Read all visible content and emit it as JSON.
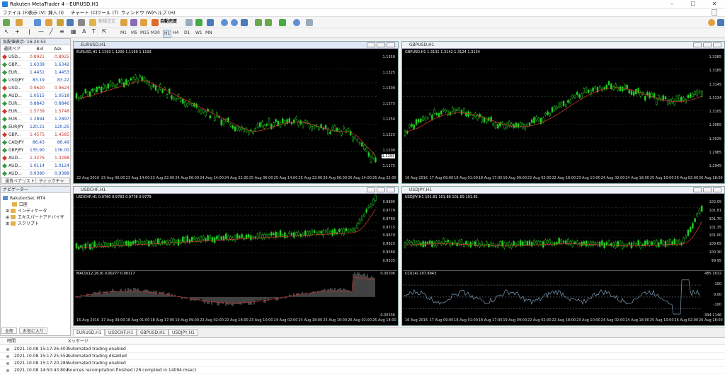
{
  "window": {
    "title": "Rakuten MetaTrader 4 - EURUSD,H1"
  },
  "menu": [
    "ファイル (F)",
    "表示 (V)",
    "挿入 (I)",
    "チャート (C)",
    "ツール (T)",
    "ウィンドウ (W)",
    "ヘルプ (H)"
  ],
  "toolbar": {
    "new_order": "新規注文",
    "auto_trade": "自動売買"
  },
  "timeframes": [
    "M1",
    "M5",
    "M15",
    "M30",
    "H1",
    "H4",
    "D1",
    "W1",
    "MN"
  ],
  "market_watch": {
    "title": "気配値表示: 16:24:53",
    "col_symbol": "通貨ペア",
    "col_bid": "Bid",
    "col_ask": "Ask",
    "rows": [
      {
        "symbol": "USD...",
        "bid": "0.8921",
        "ask": "0.8925",
        "dir": "down"
      },
      {
        "symbol": "GBP...",
        "bid": "1.6339",
        "ask": "1.6342",
        "dir": "up"
      },
      {
        "symbol": "EUR...",
        "bid": "1.4451",
        "ask": "1.4453",
        "dir": "up"
      },
      {
        "symbol": "USDJPY",
        "bid": "83.19",
        "ask": "83.22",
        "dir": "up"
      },
      {
        "symbol": "USD...",
        "bid": "0.9620",
        "ask": "0.9624",
        "dir": "down"
      },
      {
        "symbol": "AUD...",
        "bid": "1.0515",
        "ask": "1.0518",
        "dir": "up"
      },
      {
        "symbol": "EUR...",
        "bid": "0.8843",
        "ask": "0.8846",
        "dir": "up"
      },
      {
        "symbol": "EUR...",
        "bid": "1.5739",
        "ask": "1.5748",
        "dir": "down"
      },
      {
        "symbol": "EUR...",
        "bid": "1.2894",
        "ask": "1.2897",
        "dir": "up"
      },
      {
        "symbol": "EURJPY",
        "bid": "120.21",
        "ask": "120.25",
        "dir": "up"
      },
      {
        "symbol": "GBP...",
        "bid": "1.4575",
        "ask": "1.4585",
        "dir": "down"
      },
      {
        "symbol": "CADJPY",
        "bid": "86.43",
        "ask": "86.49",
        "dir": "up"
      },
      {
        "symbol": "GBPJPY",
        "bid": "135.90",
        "ask": "136.00",
        "dir": "up"
      },
      {
        "symbol": "AUD...",
        "bid": "1.3276",
        "ask": "1.3288",
        "dir": "down"
      },
      {
        "symbol": "AUD...",
        "bid": "1.0114",
        "ask": "1.0124",
        "dir": "up"
      },
      {
        "symbol": "AUD...",
        "bid": "0.9380",
        "ask": "0.9388",
        "dir": "up"
      }
    ],
    "tab_symbols": "通貨ペアリスト",
    "tab_tick": "ティックチャート"
  },
  "navigator": {
    "title": "ナビゲーター",
    "root": "RakutenSec MT4",
    "items": [
      "口座",
      "インディケータ",
      "エキスパートアドバイザ",
      "スクリプト"
    ],
    "tab_common": "全般",
    "tab_fav": "お気に入り"
  },
  "charts": [
    {
      "tab": "EURUSD,H1",
      "info": "EURUSD,H1  1.1193 1.1200 1.1190 1.1193",
      "prices": [
        "1.1350",
        "1.1325",
        "1.1300",
        "1.1275",
        "1.1250",
        "1.1225",
        "1.1200",
        "1.1175"
      ],
      "current": "1.1193",
      "times": [
        "22 Aug 2016",
        "23 Aug 06:00",
        "23 Aug 14:00",
        "23 Aug 22:00",
        "24 Aug 06:00",
        "24 Aug 14:00",
        "24 Aug 22:00",
        "25 Aug 06:00",
        "25 Aug 14:00",
        "25 Aug 22:00",
        "26 Aug 06:00",
        "26 Aug 14:00",
        "26 Aug 22:00"
      ]
    },
    {
      "tab": "GBPUSD,H1",
      "info": "GBPUSD,H1  1.3131 1.3142 1.3124 1.3134",
      "prices": [
        "1.3265",
        "1.3185",
        "1.3145",
        "1.3134",
        "1.3105",
        "1.3065",
        "1.3025",
        "1.2985",
        "1.2945"
      ],
      "times": [
        "16 Aug 2016",
        "17 Aug 09:00",
        "18 Aug 01:00",
        "18 Aug 17:00",
        "19 Aug 09:00",
        "22 Aug 02:00",
        "22 Aug 18:00",
        "23 Aug 10:00",
        "24 Aug 02:00",
        "24 Aug 18:00",
        "25 Aug 10:00",
        "26 Aug 02:00",
        "26 Aug 18:00"
      ]
    },
    {
      "tab": "USDCHF,H1",
      "info": "USDCHF,H1  0.9780 0.9782 0.9778 0.9779",
      "prices": [
        "0.9805",
        "0.9779",
        "0.9760",
        "0.9715",
        "0.9670",
        "0.9625",
        "0.9580",
        "0.9535"
      ],
      "macd_info": "MACD(12,26,9) 0.00277 0.00117",
      "macd_levels": [
        "0.00306",
        "-0.00336"
      ],
      "times": [
        "16 Aug 2016",
        "17 Aug 09:00",
        "18 Aug 01:00",
        "18 Aug 17:00",
        "19 Aug 09:00",
        "22 Aug 02:00",
        "22 Aug 18:00",
        "23 Aug 10:00",
        "24 Aug 02:00",
        "24 Aug 18:00",
        "25 Aug 10:00",
        "26 Aug 02:00",
        "26 Aug 18:00"
      ]
    },
    {
      "tab": "USDJPY,H1",
      "info": "USDJPY,H1  101.81 101.89 101.69 101.81",
      "prices": [
        "102.05",
        "101.81",
        "101.70",
        "101.35",
        "101.00",
        "100.65",
        "100.30",
        "99.95"
      ],
      "cci_info": "CCI(14) 107.6943",
      "cci_levels": [
        "485.1632",
        "100",
        "0.00",
        "-100",
        "-394.1146"
      ],
      "times": [
        "16 Aug 2016",
        "17 Aug 09:00",
        "18 Aug 01:00",
        "18 Aug 17:00",
        "19 Aug 09:00",
        "22 Aug 02:00",
        "22 Aug 18:00",
        "23 Aug 10:00",
        "24 Aug 02:00",
        "24 Aug 18:00",
        "25 Aug 10:00",
        "26 Aug 02:00",
        "26 Aug 18:00"
      ]
    }
  ],
  "terminal": {
    "col_time": "時間",
    "col_msg": "メッセージ",
    "rows": [
      {
        "time": "2021.10.08 15:17:26.407",
        "msg": "Automated trading enabled"
      },
      {
        "time": "2021.10.08 15:17:25.552",
        "msg": "Automated trading disabled"
      },
      {
        "time": "2021.10.08 15:17:20.285",
        "msg": "Automated trading enabled"
      },
      {
        "time": "2021.10.08 14:50:43.804",
        "msg": "Sources recompilation finished (28 compiled in 14094 msec)"
      }
    ]
  },
  "colors": {
    "bull": "#22cc22",
    "ma": "#c0392b",
    "up_arrow": "#2e9e3e",
    "down_arrow": "#d0392b",
    "bid_down": "#c0392b",
    "bid_up": "#1a4fb3"
  }
}
